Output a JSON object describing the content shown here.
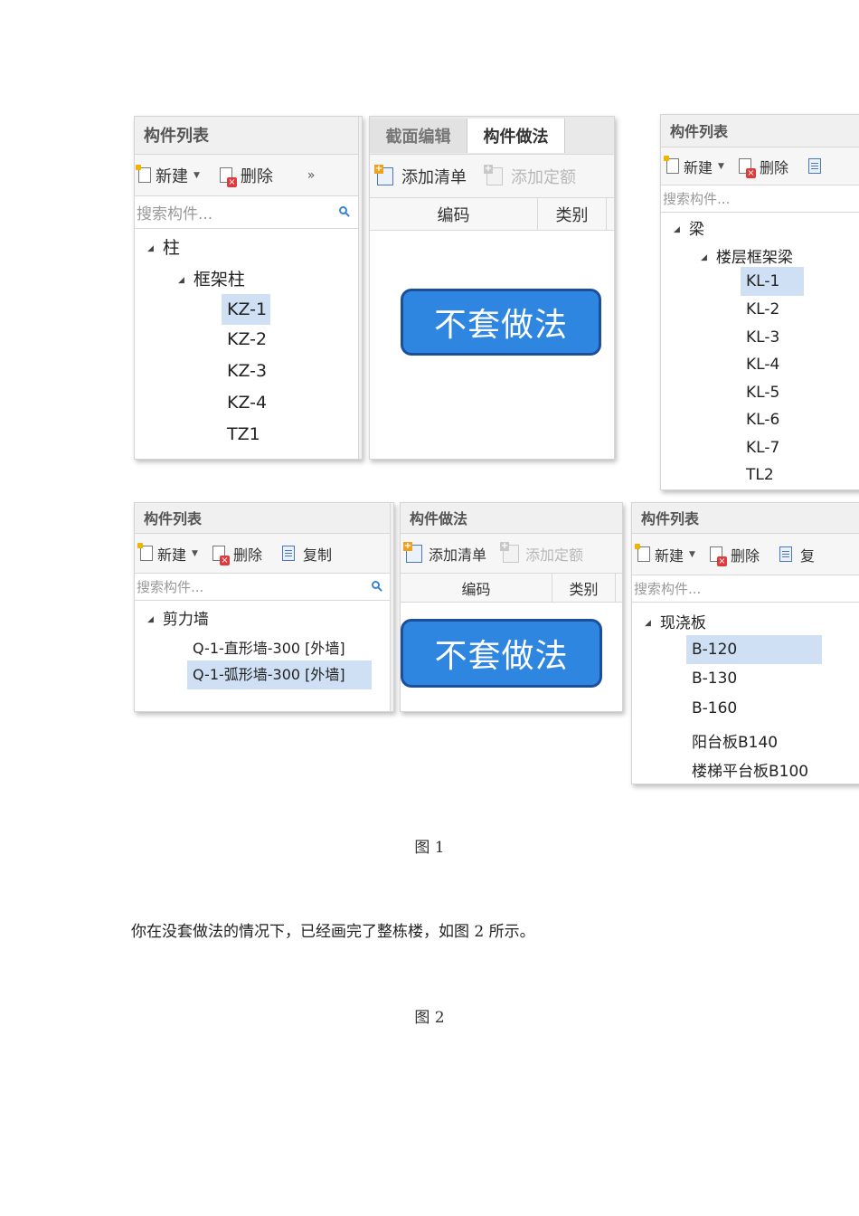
{
  "fig1": {
    "column_panel": {
      "header": "构件列表",
      "toolbar": {
        "new": "新建",
        "delete": "删除",
        "more": "»"
      },
      "search_placeholder": "搜索构件...",
      "tree": {
        "root": "柱",
        "group": "框架柱",
        "items": [
          "KZ-1",
          "KZ-2",
          "KZ-3",
          "KZ-4",
          "TZ1"
        ],
        "selected": "KZ-1"
      }
    },
    "column_method_panel": {
      "tabs": [
        "截面编辑",
        "构件做法"
      ],
      "active_tab": "构件做法",
      "toolbar": {
        "add_list": "添加清单",
        "add_quota": "添加定额"
      },
      "columns": [
        "编码",
        "类别"
      ],
      "button": "不套做法"
    },
    "beam_panel": {
      "header": "构件列表",
      "toolbar": {
        "new": "新建",
        "delete": "删除"
      },
      "search_placeholder": "搜索构件...",
      "tree": {
        "root": "梁",
        "group": "楼层框架梁",
        "items": [
          "KL-1",
          "KL-2",
          "KL-3",
          "KL-4",
          "KL-5",
          "KL-6",
          "KL-7",
          "TL2"
        ],
        "selected": "KL-1"
      }
    },
    "wall_panel": {
      "header": "构件列表",
      "toolbar": {
        "new": "新建",
        "delete": "删除",
        "copy": "复制"
      },
      "search_placeholder": "搜索构件...",
      "tree": {
        "root": "剪力墙",
        "items": [
          "Q-1-直形墙-300 [外墙]",
          "Q-1-弧形墙-300 [外墙]"
        ],
        "selected": "Q-1-弧形墙-300 [外墙]"
      }
    },
    "wall_method_panel": {
      "header": "构件做法",
      "toolbar": {
        "add_list": "添加清单",
        "add_quota": "添加定额"
      },
      "columns": [
        "编码",
        "类别"
      ],
      "button": "不套做法"
    },
    "slab_panel": {
      "header": "构件列表",
      "toolbar": {
        "new": "新建",
        "delete": "删除",
        "copy": "复"
      },
      "search_placeholder": "搜索构件...",
      "tree": {
        "root": "现浇板",
        "items": [
          "B-120",
          "B-130",
          "B-160",
          "阳台板B140",
          "楼梯平台板B100"
        ],
        "selected": "B-120"
      }
    },
    "caption": "图 1"
  },
  "paragraph": "你在没套做法的情况下，已经画完了整栋楼，如图 2 所示。",
  "fig2": {
    "caption": "图 2"
  },
  "colors": {
    "accent": "#2f86e0",
    "selection": "#cfe0f4",
    "button_border": "#1c4f9a"
  }
}
